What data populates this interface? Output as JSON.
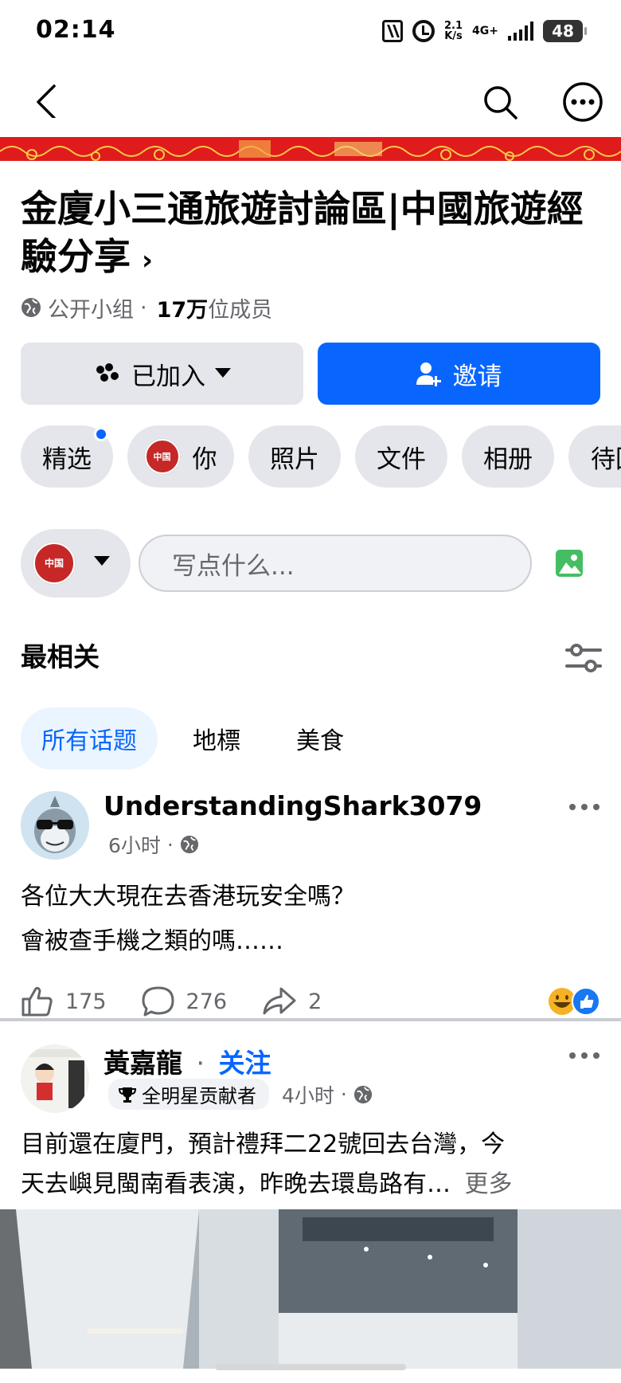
{
  "status_bar": {
    "time": "02:14",
    "speed_top": "2.1",
    "speed_bottom": "K/s",
    "network": "4G+",
    "battery": "48"
  },
  "nav": {
    "back_icon": "chevron-left-icon",
    "search_icon": "search-icon",
    "more_icon": "more-icon"
  },
  "group": {
    "name": "金廈小三通旅遊討論區|中國旅遊經驗分享",
    "name_chevron": "›",
    "privacy": "公开小组",
    "separator": "·",
    "member_count": "17万",
    "member_suffix": "位成员"
  },
  "buttons": {
    "joined_label": "已加入",
    "invite_label": "邀请"
  },
  "chips": [
    {
      "label": "精选",
      "has_dot": true
    },
    {
      "label": "你",
      "has_avatar": true
    },
    {
      "label": "照片"
    },
    {
      "label": "文件"
    },
    {
      "label": "相册"
    },
    {
      "label": "待回"
    }
  ],
  "group_avatar_text": "中国",
  "composer": {
    "placeholder": "写点什么..."
  },
  "sort": {
    "title": "最相关"
  },
  "topic_tabs": [
    {
      "label": "所有话题",
      "active": true
    },
    {
      "label": "地標",
      "active": false
    },
    {
      "label": "美食",
      "active": false
    }
  ],
  "posts": [
    {
      "author": "UnderstandingShark3079",
      "time": "6小时",
      "dot": "·",
      "text_lines": [
        "各位大大現在去香港玩安全嗎？",
        "會被查手機之類的嗎……"
      ],
      "likes": "175",
      "comments": "276",
      "shares": "2"
    },
    {
      "author": "黃嘉龍",
      "dot": "·",
      "follow": "关注",
      "badge": "全明星贡献者",
      "time": "4小时",
      "text_lines": [
        "目前還在廈門，預計禮拜二22號回去台灣，今",
        "天去嶼見閩南看表演，昨晚去環島路有…"
      ],
      "more": "更多"
    }
  ],
  "colors": {
    "accent": "#0866ff",
    "chip_bg": "#e4e6eb",
    "secondary_text": "#65676b",
    "banner_red": "#e41d1d"
  }
}
